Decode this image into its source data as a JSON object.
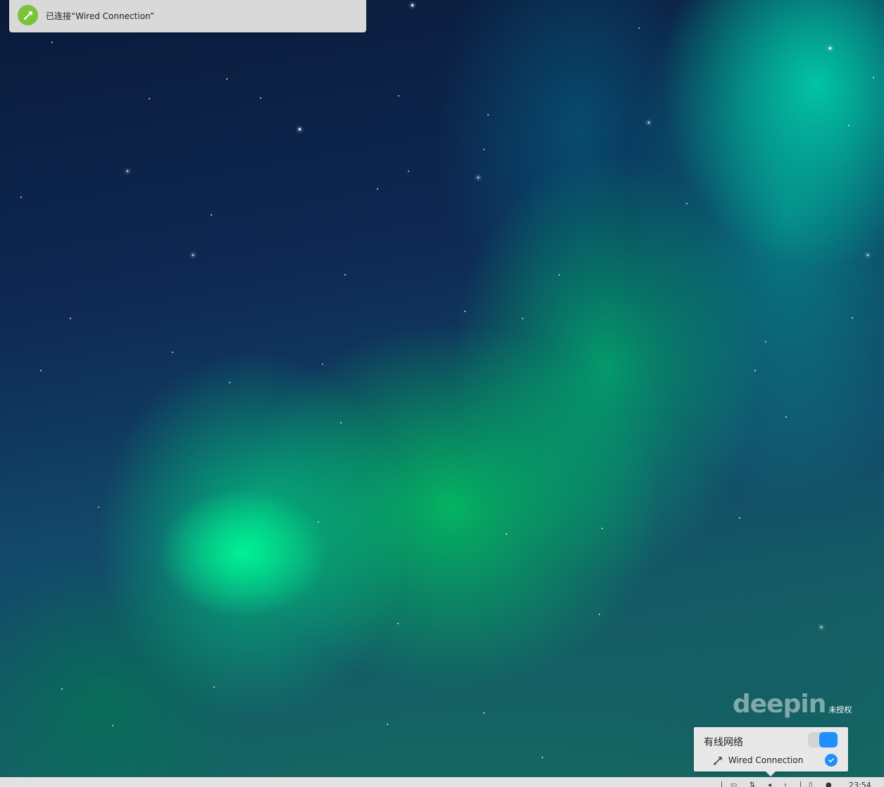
{
  "notification": {
    "message": "已连接“Wired Connection”",
    "icon": "network-wired-icon",
    "accent_color": "#7cc23a"
  },
  "watermark": {
    "logo": "deepin",
    "label": "未授权"
  },
  "network_popup": {
    "title": "有线网络",
    "toggle_on": true,
    "accent_color": "#1e8ffb",
    "connections": [
      {
        "name": "Wired Connection",
        "icon": "wired-connection-icon",
        "connected": true
      }
    ]
  },
  "taskbar": {
    "clock": "23:54",
    "tray_icons": [
      "notification-icon",
      "network-icon",
      "volume-icon",
      "power-icon",
      "clipboard-icon",
      "user-icon"
    ]
  }
}
